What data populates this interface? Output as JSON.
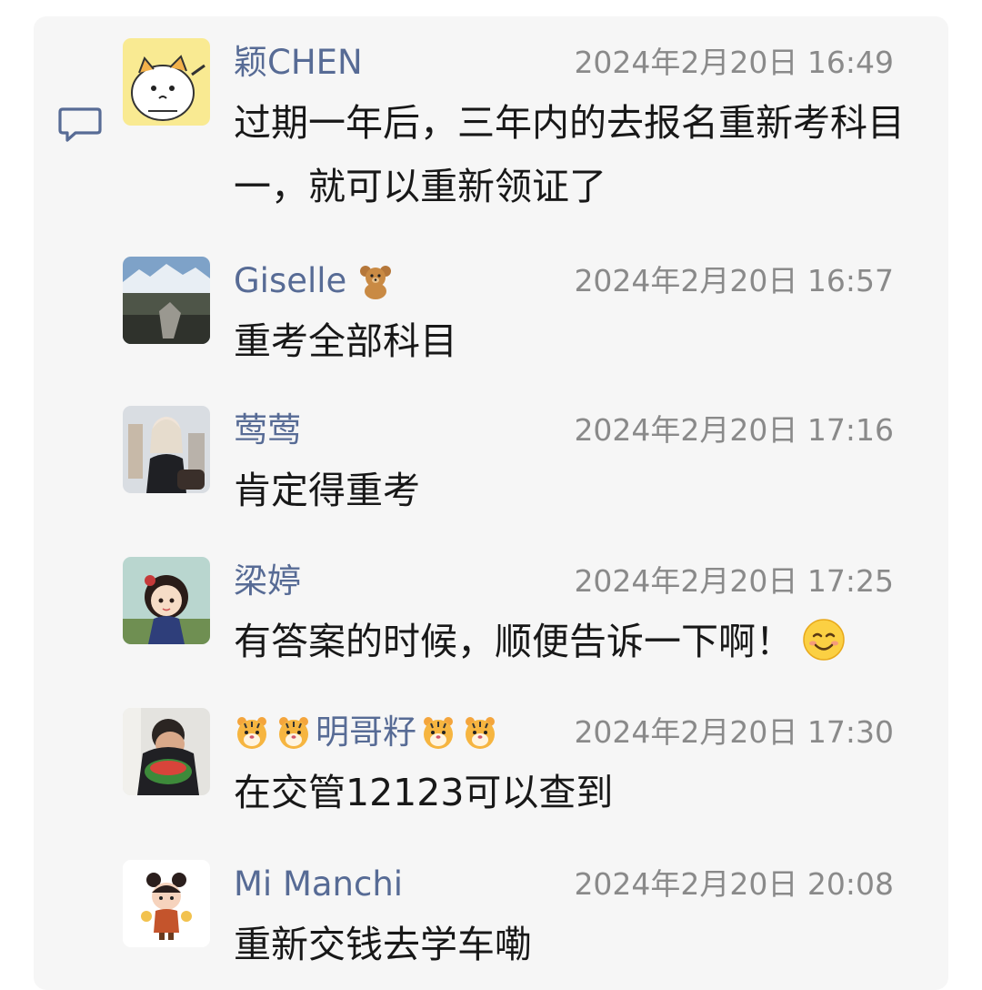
{
  "colors": {
    "name": "#576b95",
    "time": "#8a8a8a",
    "text": "#181818",
    "panel": "#f6f6f6"
  },
  "comments": [
    {
      "name": "颖CHEN",
      "time": "2024年2月20日 16:49",
      "text": "过期一年后，三年内的去报名重新考科目一，就可以重新领证了",
      "avatar": "cartoon-cat-avatar"
    },
    {
      "name": "Giselle",
      "name_emoji": "teddy-bear",
      "time": "2024年2月20日 16:57",
      "text": "重考全部科目",
      "avatar": "mountain-photo-avatar"
    },
    {
      "name": "莺莺",
      "time": "2024年2月20日 17:16",
      "text": "肯定得重考",
      "avatar": "woman-photo-avatar"
    },
    {
      "name": "梁婷",
      "time": "2024年2月20日 17:25",
      "text": "有答案的时候，顺便告诉一下啊！",
      "text_emoji": "smiling-face",
      "avatar": "anime-girl-avatar"
    },
    {
      "name": "明哥籽",
      "name_emoji": "tiger-face",
      "time": "2024年2月20日 17:30",
      "text": "在交管12123可以查到",
      "avatar": "watermelon-man-photo-avatar"
    },
    {
      "name": "Mi Manchi",
      "time": "2024年2月20日 20:08",
      "text": "重新交钱去学车嘞",
      "avatar": "cartoon-doll-avatar"
    }
  ]
}
